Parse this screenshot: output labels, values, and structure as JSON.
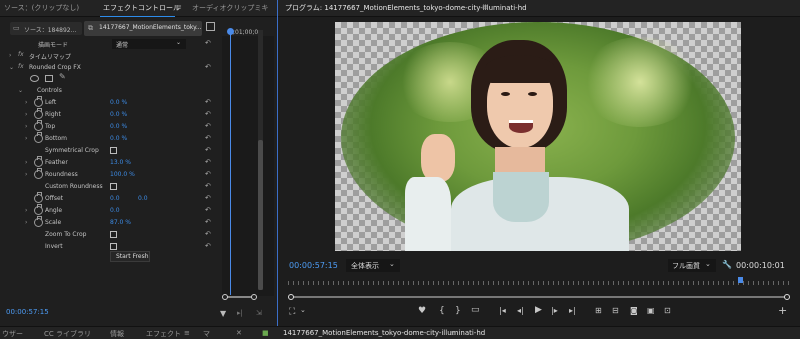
{
  "left_panel": {
    "tabs": [
      {
        "label": "ソース：(クリップなし)"
      },
      {
        "label": "エフェクトコントロール"
      },
      {
        "label": "≡"
      },
      {
        "label": "オーディオクリップミキ"
      }
    ],
    "source_label": "ソース：184892...",
    "clip_label": "14177667_MotionElements_toky...",
    "timeline_time": ";01;00;0",
    "blend_mode_label": "描画モード",
    "blend_mode_value": "通常",
    "time_remap_label": "タイムリマップ",
    "effect_name": "Rounded Crop FX",
    "controls_label": "Controls",
    "params": [
      {
        "label": "Left",
        "value": "0.0 %"
      },
      {
        "label": "Right",
        "value": "0.0 %"
      },
      {
        "label": "Top",
        "value": "0.0 %"
      },
      {
        "label": "Bottom",
        "value": "0.0 %"
      },
      {
        "label": "Symmetrical Crop",
        "value": ""
      },
      {
        "label": "Feather",
        "value": "13.0 %"
      },
      {
        "label": "Roundness",
        "value": "100.0 %"
      },
      {
        "label": "Custom Roundness",
        "value": ""
      },
      {
        "label": "Offset",
        "value": "0.0",
        "value2": "0.0"
      },
      {
        "label": "Angle",
        "value": "0.0"
      },
      {
        "label": "Scale",
        "value": "87.0 %"
      },
      {
        "label": "Zoom To Crop",
        "value": ""
      },
      {
        "label": "Invert",
        "value": ""
      }
    ],
    "start_fresh_label": "Start Fresh",
    "current_time": "00:00:57:15"
  },
  "program": {
    "title": "プログラム: 14177667_MotionElements_tokyo-dome-city-illuminati-hd",
    "current_time": "00:00:57:15",
    "zoom_value": "全体表示",
    "quality_value": "フル画質",
    "duration": "00:00:10:01"
  },
  "bottom_bar": {
    "tabs": [
      {
        "label": "ウザー"
      },
      {
        "label": "CC ライブラリ"
      },
      {
        "label": "情報"
      },
      {
        "label": "エフェクト"
      },
      {
        "label": "≡"
      },
      {
        "label": "マ"
      }
    ],
    "sequence_label": "14177667_MotionElements_tokyo-dome-city-illuminati-hd"
  }
}
